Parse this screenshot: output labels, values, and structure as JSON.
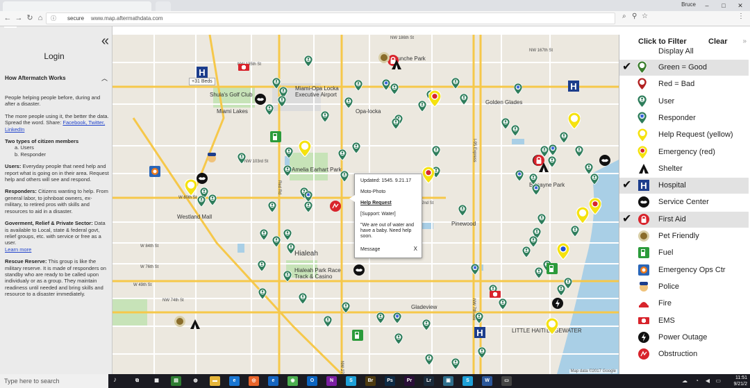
{
  "browser": {
    "user_label": "Bruce",
    "security_label": "secure",
    "url": "www.map.aftermathdata.com"
  },
  "sidebar": {
    "login_label": "Login",
    "how_title": "How Aftermatch Works",
    "intro": "People helping people before, during and after a disaster.",
    "more_people": "The more people using it, the better the data. Spread the word. Share:",
    "share_links": "Facebook, Twitter, LinkedIn",
    "two_types_title": "Two types of citizen members",
    "two_types_a": "a. Users",
    "two_types_b": "b. Responder",
    "users_title": "Users:",
    "users_text": "Everyday people that need help and report what is going on in their area. Request help and others will see and respond.",
    "responders_title": "Responders:",
    "responders_text": "Citizens wanting to help. From general labor, to johnboat owners, ex-military, to retired pros with skills and resources to aid in a disaster.",
    "govt_title": "Goverment, Relief & Private Sector:",
    "govt_text": "Data is available to Local, state & federal govt, relief groups, etc. with service or free as a user.",
    "learn_more": "Learn more",
    "rescue_title": "Rescue Reserve:",
    "rescue_text": "This group is  like the military reserve. It is made of responders on standby who are ready to be called upon individualy or as a group. They maintain readiness until needed and bring skills and resource to a disaster immediately."
  },
  "map": {
    "beds_label": "+31 Beds",
    "credit": "Map data ©2017 Google",
    "places": [
      {
        "name": "Shula's Golf Club",
        "size": "n"
      },
      {
        "name": "Miami Lakes",
        "size": "n"
      },
      {
        "name": "Miami-Opa Locka Executive Airport",
        "size": "n"
      },
      {
        "name": "Opa-locka",
        "size": "n"
      },
      {
        "name": "Bunche Park",
        "size": "n"
      },
      {
        "name": "Golden Glades",
        "size": "n"
      },
      {
        "name": "Amelia Earhart Park",
        "size": "n"
      },
      {
        "name": "Biscayne Park",
        "size": "n"
      },
      {
        "name": "Westland Mall",
        "size": "n"
      },
      {
        "name": "Pinewood",
        "size": "n"
      },
      {
        "name": "Hialeah",
        "size": "big"
      },
      {
        "name": "Hialeah Park Race Track & Casino",
        "size": "n"
      },
      {
        "name": "Gladeview",
        "size": "n"
      },
      {
        "name": "LITTLE HAITI",
        "size": "n"
      },
      {
        "name": "EDGEWATER",
        "size": "n"
      }
    ],
    "roads": [
      "NW 186th St",
      "NW 167th St",
      "W 60th St",
      "W 49th St",
      "NW 74th St",
      "NW 62nd St",
      "NW 103rd St",
      "NW 135th St",
      "Red Rd",
      "NW 27th Ave",
      "NW 7th Ave",
      "I-95 Express",
      "W 84th St",
      "W 76th St"
    ]
  },
  "popup": {
    "updated": "Updated: 1545. 9.21.17",
    "type": "Moto-Photo",
    "title": "Help Request",
    "support": "[Support: Water]",
    "message_text": "\"We are out of water and have a baby. Need help soon.",
    "message_label": "Message",
    "close_label": "X"
  },
  "legend": {
    "title": "Click to Filter",
    "clear_label": "Clear",
    "display_all": "Display All",
    "items": [
      {
        "label": "Green = Good",
        "selected": true,
        "icon": "green-pin-icon"
      },
      {
        "label": "Red = Bad",
        "selected": false,
        "icon": "red-pin-icon"
      },
      {
        "label": "User",
        "selected": false,
        "icon": "user-pin-icon"
      },
      {
        "label": "Responder",
        "selected": false,
        "icon": "responder-pin-icon"
      },
      {
        "label": "Help Request (yellow)",
        "selected": false,
        "icon": "help-request-pin-icon"
      },
      {
        "label": "Emergency (red)",
        "selected": false,
        "icon": "emergency-pin-icon"
      },
      {
        "label": "Shelter",
        "selected": false,
        "icon": "shelter-icon"
      },
      {
        "label": "Hospital",
        "selected": true,
        "icon": "hospital-icon"
      },
      {
        "label": "Service Center",
        "selected": false,
        "icon": "service-center-icon"
      },
      {
        "label": "First Aid",
        "selected": true,
        "icon": "first-aid-icon"
      },
      {
        "label": "Pet Friendly",
        "selected": false,
        "icon": "pet-friendly-icon"
      },
      {
        "label": "Fuel",
        "selected": false,
        "icon": "fuel-icon"
      },
      {
        "label": "Emergency Ops Ctr",
        "selected": false,
        "icon": "emergency-ops-icon"
      },
      {
        "label": "Police",
        "selected": false,
        "icon": "police-icon"
      },
      {
        "label": "Fire",
        "selected": false,
        "icon": "fire-icon"
      },
      {
        "label": "EMS",
        "selected": false,
        "icon": "ems-icon"
      },
      {
        "label": "Power Outage",
        "selected": false,
        "icon": "power-outage-icon"
      },
      {
        "label": "Obstruction",
        "selected": false,
        "icon": "obstruction-icon"
      }
    ]
  },
  "taskbar": {
    "search_placeholder": "Type here to search",
    "time": "11:51",
    "date": "9/21/2"
  },
  "colors": {
    "user_pin": "#2e7d5b",
    "responder_pin": "#1f4fd6",
    "help_pin": "#f5e20f",
    "emergency_pin": "#d8242c",
    "hospital": "#1c3d8c",
    "water": "#a9cfe6",
    "park": "#c7e3b8",
    "highway": "#f6c84a"
  }
}
